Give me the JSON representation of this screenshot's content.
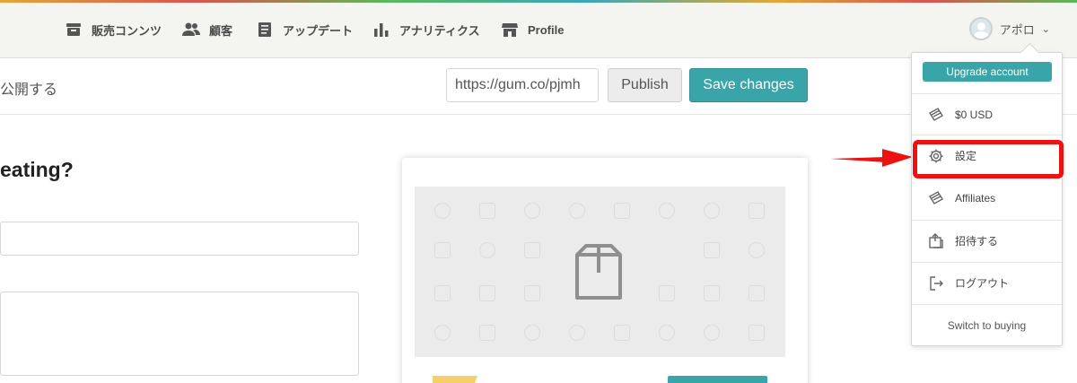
{
  "nav": {
    "items": [
      {
        "label": "販売コンンツ",
        "icon": "inbox-icon"
      },
      {
        "label": "顧客",
        "icon": "users-icon"
      },
      {
        "label": "アップデート",
        "icon": "document-icon"
      },
      {
        "label": "アナリティクス",
        "icon": "bar-chart-icon"
      },
      {
        "label": "Profile",
        "icon": "store-icon"
      }
    ],
    "user_name": "アポロ"
  },
  "subbar": {
    "title": "公開する",
    "url_value": "https://gum.co/pjmh",
    "publish_label": "Publish",
    "save_label": "Save changes"
  },
  "main": {
    "heading": "eating?"
  },
  "dropdown": {
    "upgrade_label": "Upgrade account",
    "items": [
      {
        "label": "$0 USD",
        "icon": "ticket-icon"
      },
      {
        "label": "設定",
        "icon": "gear-icon"
      },
      {
        "label": "Affiliates",
        "icon": "ticket-icon"
      },
      {
        "label": "招待する",
        "icon": "invite-icon"
      },
      {
        "label": "ログアウト",
        "icon": "logout-icon"
      }
    ],
    "switch_label": "Switch to buying"
  },
  "colors": {
    "accent": "#3aa5a8",
    "highlight": "#ee1111",
    "nav_bg": "#f4f4f0"
  }
}
